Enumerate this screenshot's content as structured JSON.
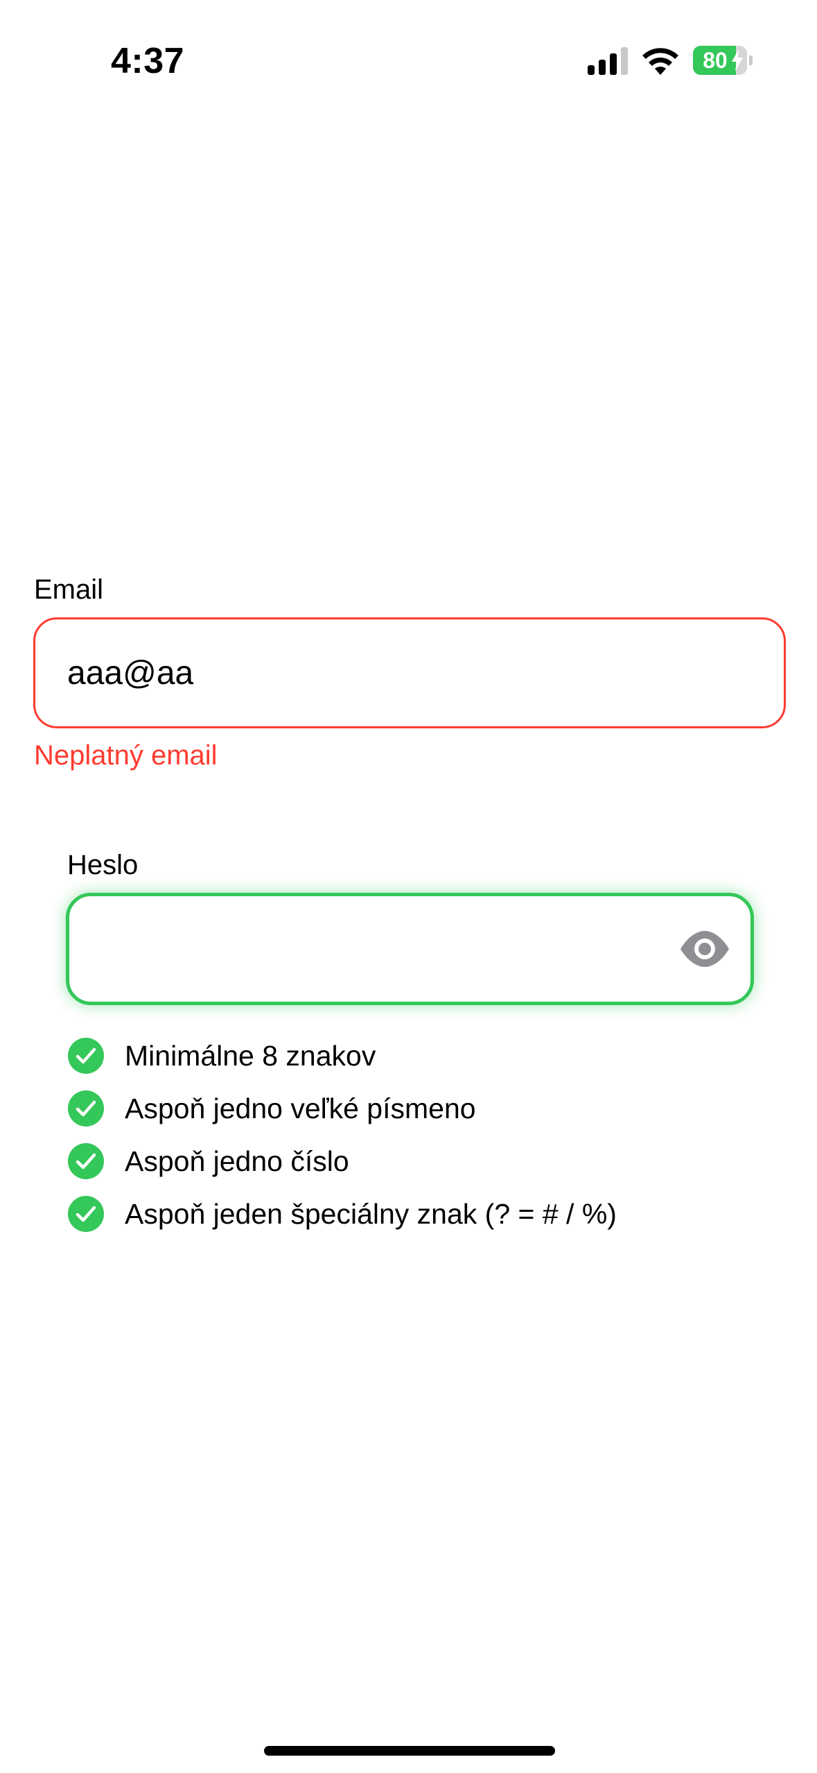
{
  "status_bar": {
    "time": "4:37",
    "battery_percent": "80",
    "battery_level": 0.8,
    "charging": true,
    "icons": [
      "signal-icon",
      "wifi-icon",
      "battery-icon",
      "charging-bolt-icon"
    ]
  },
  "email": {
    "label": "Email",
    "value": "aaa@aa",
    "error": "Neplatný email"
  },
  "password": {
    "label": "Heslo",
    "value": "",
    "toggle_icon": "eye-icon"
  },
  "requirements": [
    {
      "text": "Minimálne 8 znakov",
      "met": true
    },
    {
      "text": "Aspoň jedno veľké písmeno",
      "met": true
    },
    {
      "text": "Aspoň jedno číslo",
      "met": true
    },
    {
      "text": "Aspoň jeden špeciálny znak (? = # / %)",
      "met": true
    }
  ],
  "colors": {
    "error": "#ff3b30",
    "success": "#34c759",
    "icon_gray": "#8e8e93",
    "text": "#000000",
    "background": "#ffffff"
  }
}
